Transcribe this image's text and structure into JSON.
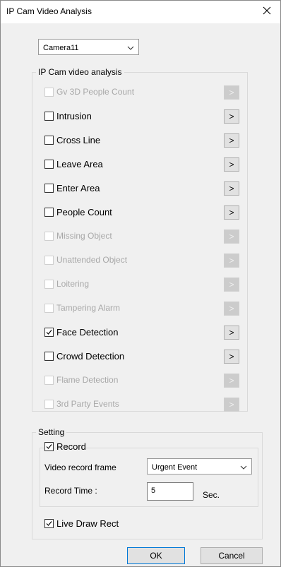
{
  "window": {
    "title": "IP Cam Video Analysis"
  },
  "camera_select": {
    "value": "Camera11"
  },
  "analysis_group": {
    "title": "IP Cam video analysis",
    "items": [
      {
        "label": "Gv 3D People Count",
        "checked": false,
        "enabled": false,
        "button": ">"
      },
      {
        "label": "Intrusion",
        "checked": false,
        "enabled": true,
        "button": ">"
      },
      {
        "label": "Cross Line",
        "checked": false,
        "enabled": true,
        "button": ">"
      },
      {
        "label": "Leave Area",
        "checked": false,
        "enabled": true,
        "button": ">"
      },
      {
        "label": "Enter Area",
        "checked": false,
        "enabled": true,
        "button": ">"
      },
      {
        "label": "People Count",
        "checked": false,
        "enabled": true,
        "button": ">"
      },
      {
        "label": "Missing Object",
        "checked": false,
        "enabled": false,
        "button": ">"
      },
      {
        "label": "Unattended Object",
        "checked": false,
        "enabled": false,
        "button": ">"
      },
      {
        "label": "Loitering",
        "checked": false,
        "enabled": false,
        "button": ">"
      },
      {
        "label": "Tampering Alarm",
        "checked": false,
        "enabled": false,
        "button": ">"
      },
      {
        "label": "Face Detection",
        "checked": true,
        "enabled": true,
        "button": ">"
      },
      {
        "label": "Crowd Detection",
        "checked": false,
        "enabled": true,
        "button": ">"
      },
      {
        "label": "Flame Detection",
        "checked": false,
        "enabled": false,
        "button": ">"
      },
      {
        "label": "3rd Party Events",
        "checked": false,
        "enabled": false,
        "button": ">"
      }
    ]
  },
  "setting_group": {
    "title": "Setting",
    "record": {
      "label": "Record",
      "checked": true
    },
    "video_record_frame": {
      "label": "Video record frame",
      "value": "Urgent Event"
    },
    "record_time": {
      "label": "Record Time :",
      "value": "5",
      "unit": "Sec."
    },
    "live_draw_rect": {
      "label": "Live Draw Rect",
      "checked": true
    }
  },
  "buttons": {
    "ok": "OK",
    "cancel": "Cancel"
  }
}
